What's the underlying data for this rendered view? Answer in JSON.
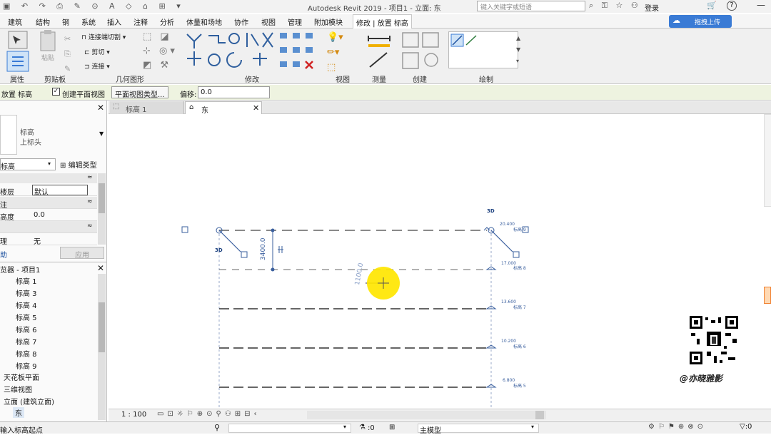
{
  "titlebar": {
    "title": "Autodesk Revit 2019 - 项目1 - 立面: 东",
    "search_placeholder": "键入关键字或短语",
    "login": "登录",
    "upload": "拖拽上传"
  },
  "tabs": [
    "建筑",
    "结构",
    "钢",
    "系统",
    "插入",
    "注释",
    "分析",
    "体量和场地",
    "协作",
    "视图",
    "管理",
    "附加模块",
    "修改 | 放置 标高"
  ],
  "ribbon_groups": {
    "properties": "属性",
    "clipboard": "剪贴板",
    "geometry": "几何图形",
    "modify": "修改",
    "view": "视图",
    "measure": "测量",
    "create": "创建",
    "draw": "绘制",
    "paste": "粘贴",
    "join_cut": "连接端切割",
    "cut": "剪切",
    "join": "连接"
  },
  "options": {
    "place_level": "放置 标高",
    "create_plan": "创建平面视图",
    "plan_type": "平面视图类型...",
    "offset_label": "偏移:",
    "offset_value": "0.0"
  },
  "properties": {
    "type_name": "标高",
    "type_sub": "上标头",
    "filter": "标高",
    "edit_type": "编辑类型",
    "rows": [
      {
        "label": "楼层",
        "value": "默认"
      },
      {
        "label": "注",
        "value": ""
      },
      {
        "label": "高度",
        "value": "0.0"
      },
      {
        "label": "理",
        "value": "无"
      }
    ],
    "help": "助",
    "apply": "应用"
  },
  "browser": {
    "title": "览器 - 项目1",
    "items": [
      "标高 1",
      "标高 3",
      "标高 4",
      "标高 5",
      "标高 6",
      "标高 7",
      "标高 8",
      "标高 9"
    ],
    "ceiling": "天花板平面",
    "threed": "三维视图",
    "elev": "立面 (建筑立面)",
    "east": "东"
  },
  "view_tabs": [
    "标高 1",
    "东"
  ],
  "canvas": {
    "label3d": "3D",
    "dim": "3400.0",
    "dim2": "1100.0",
    "levels": [
      {
        "elev": "20.400",
        "name": "标高 9"
      },
      {
        "elev": "17.000",
        "name": "标高 8"
      },
      {
        "elev": "13.600",
        "name": "标高 7"
      },
      {
        "elev": "10.200",
        "name": "标高 6"
      },
      {
        "elev": "6.800",
        "name": "标高 5"
      }
    ],
    "watermark": "@亦晓雅影"
  },
  "view_status": {
    "scale": "1 : 100"
  },
  "statusbar": {
    "hint": "输入标高起点",
    "zero": ":0",
    "model": "主模型"
  },
  "colors": {
    "accent": "#3a7bd5",
    "level_line": "#333333",
    "level_blue": "#4a6fa5",
    "cursor_yellow": "#ffe600"
  }
}
